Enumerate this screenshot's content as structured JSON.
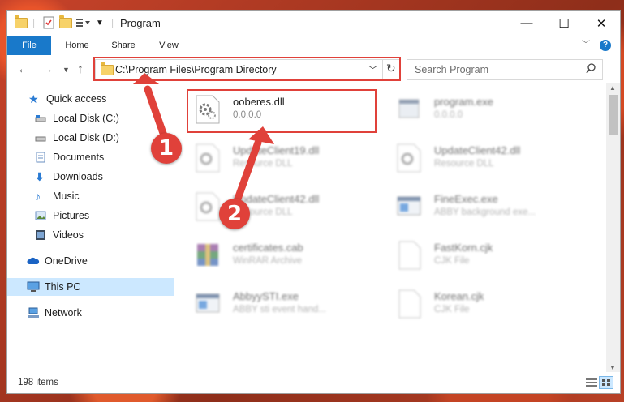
{
  "window": {
    "title": "Program",
    "controls": {
      "minimize": "—",
      "maximize": "☐",
      "close": "✕"
    }
  },
  "ribbon": {
    "tabs": [
      {
        "label": "File"
      },
      {
        "label": "Home"
      },
      {
        "label": "Share"
      },
      {
        "label": "View"
      }
    ],
    "help": "?"
  },
  "address": {
    "path": "C:\\Program Files\\Program Directory"
  },
  "search": {
    "placeholder": "Search Program"
  },
  "sidebar": {
    "items": [
      {
        "label": "Quick access"
      },
      {
        "label": "Local Disk (C:)"
      },
      {
        "label": "Local Disk (D:)"
      },
      {
        "label": "Documents"
      },
      {
        "label": "Downloads"
      },
      {
        "label": "Music"
      },
      {
        "label": "Pictures"
      },
      {
        "label": "Videos"
      },
      {
        "label": "OneDrive"
      },
      {
        "label": "This PC"
      },
      {
        "label": "Network"
      }
    ]
  },
  "files": [
    {
      "name": "ooberes.dll",
      "desc": "0.0.0.0"
    },
    {
      "name": "program.exe",
      "desc": "0.0.0.0"
    },
    {
      "name": "UpdateClient19.dll",
      "desc": "Resource DLL"
    },
    {
      "name": "UpdateClient42.dll",
      "desc": "Resource DLL"
    },
    {
      "name": "UpdateClient42.dll",
      "desc": "Resource DLL"
    },
    {
      "name": "FineExec.exe",
      "desc": "ABBY background exe..."
    },
    {
      "name": "certificates.cab",
      "desc": "WinRAR Archive"
    },
    {
      "name": "FastKorn.cjk",
      "desc": "CJK File"
    },
    {
      "name": "AbbyySTI.exe",
      "desc": "ABBY sti event hand..."
    },
    {
      "name": "Korean.cjk",
      "desc": "CJK File"
    }
  ],
  "status": {
    "count": "198 items"
  },
  "annotations": {
    "one": "1",
    "two": "2"
  },
  "colors": {
    "accent": "#1979ca",
    "highlight": "#e0413a",
    "selected_nav": "#cce8ff"
  }
}
